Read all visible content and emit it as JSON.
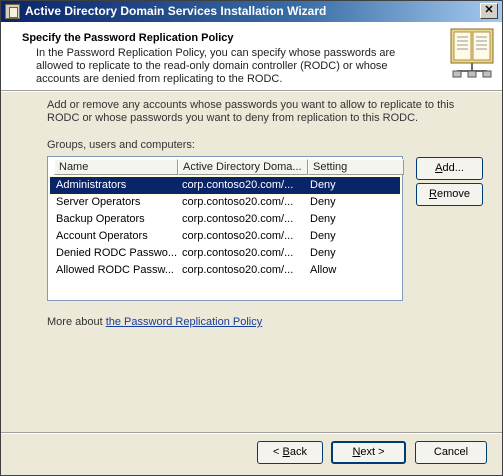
{
  "window": {
    "title": "Active Directory Domain Services Installation Wizard"
  },
  "header": {
    "title": "Specify the Password Replication Policy",
    "description": "In the Password Replication Policy, you can specify whose passwords are allowed to replicate to the read-only domain controller (RODC) or whose accounts are denied from replicating to the RODC."
  },
  "content": {
    "intro": "Add or remove any accounts whose passwords you want to allow to replicate to this RODC or whose passwords you want to deny from replication to this RODC.",
    "list_label": "Groups, users and computers:",
    "columns": [
      "Name",
      "Active Directory Doma...",
      "Setting"
    ],
    "rows": [
      {
        "name": "Administrators",
        "domain": "corp.contoso20.com/...",
        "setting": "Deny",
        "selected": true
      },
      {
        "name": "Server Operators",
        "domain": "corp.contoso20.com/...",
        "setting": "Deny"
      },
      {
        "name": "Backup Operators",
        "domain": "corp.contoso20.com/...",
        "setting": "Deny"
      },
      {
        "name": "Account Operators",
        "domain": "corp.contoso20.com/...",
        "setting": "Deny"
      },
      {
        "name": "Denied RODC Passwo...",
        "domain": "corp.contoso20.com/...",
        "setting": "Deny"
      },
      {
        "name": "Allowed RODC Passw...",
        "domain": "corp.contoso20.com/...",
        "setting": "Allow"
      }
    ],
    "more_prefix": "More about ",
    "more_link": "the Password Replication Policy"
  },
  "buttons": {
    "add": {
      "key": "A",
      "rest": "dd..."
    },
    "remove": {
      "key": "R",
      "rest": "emove"
    },
    "back": {
      "pre": "< ",
      "key": "B",
      "rest": "ack"
    },
    "next": {
      "key": "N",
      "rest": "ext >"
    },
    "cancel": "Cancel"
  }
}
